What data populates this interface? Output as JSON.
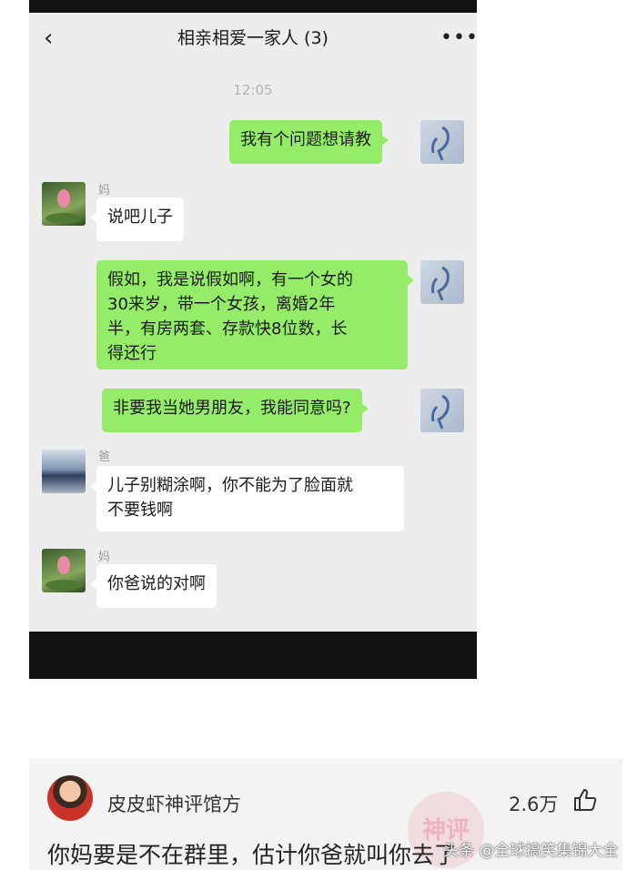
{
  "chat": {
    "title": "相亲相爱一家人 (3)",
    "back_icon": "‹",
    "more_icon": "•••",
    "time": "12:05",
    "messages": [
      {
        "sender": "me",
        "text": "我有个问题想请教"
      },
      {
        "sender": "妈",
        "text": "说吧儿子"
      },
      {
        "sender": "me",
        "lines": [
          "假如，我是说假如啊，有一个女的",
          "30来岁，带一个女孩，离婚2年",
          "半，有房两套、存款快8位数，长",
          "得还行"
        ]
      },
      {
        "sender": "me",
        "text": "非要我当她男朋友，我能同意吗?"
      },
      {
        "sender": "爸",
        "lines": [
          "儿子别糊涂啊，你不能为了脸面就",
          "不要钱啊"
        ]
      },
      {
        "sender": "妈",
        "text": "你爸说的对啊"
      }
    ]
  },
  "comment": {
    "username": "皮皮虾神评馆方",
    "likes": "2.6万",
    "text": "你妈要是不在群里，估计你爸就叫你去了",
    "stamp": "神评"
  },
  "watermark": "头条 @全球搞笑集锦大全",
  "colors": {
    "green_bubble": "#95ec69",
    "chat_bg": "#ededed"
  }
}
